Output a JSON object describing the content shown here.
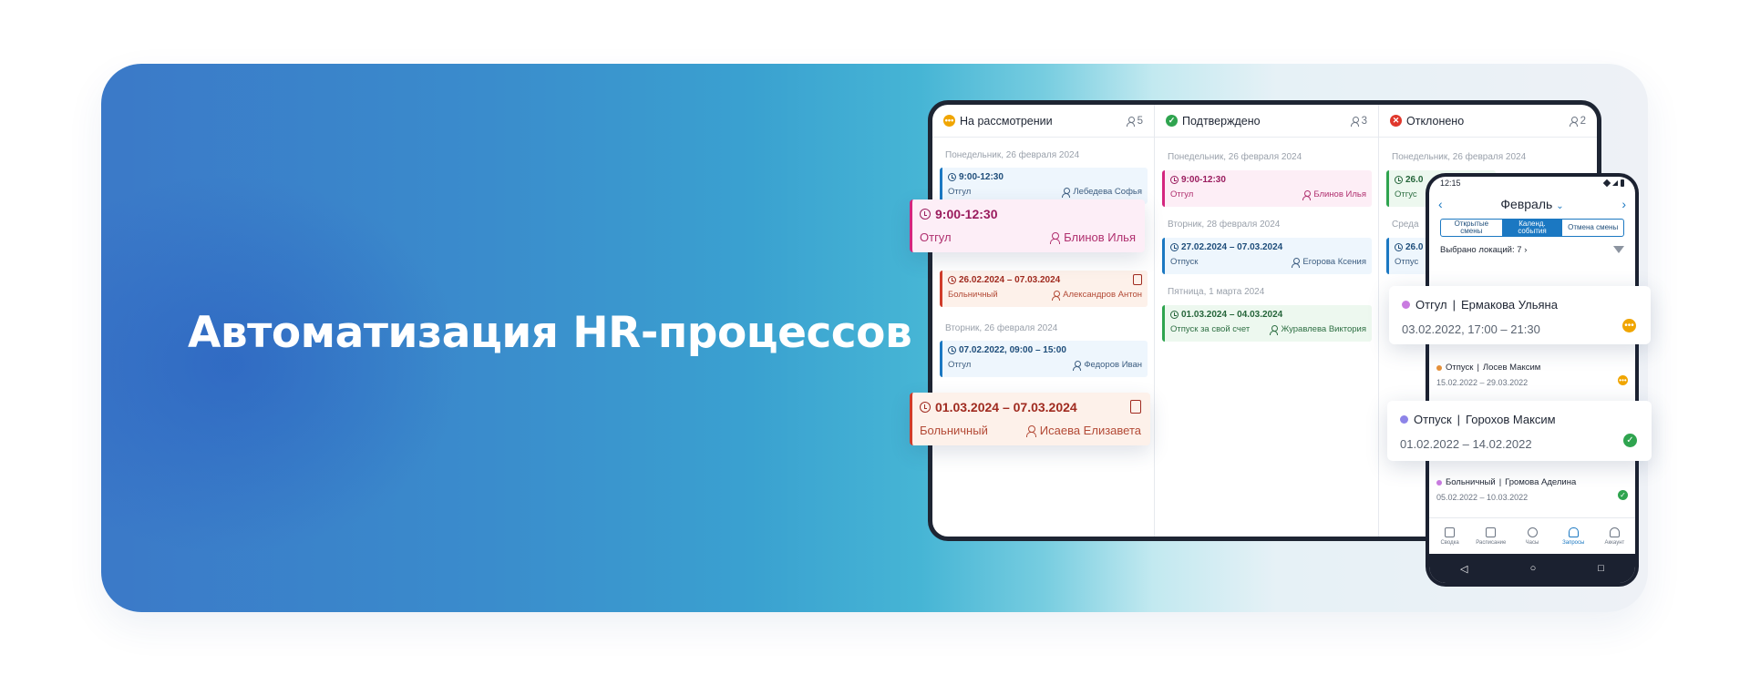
{
  "headline": "Автоматизация HR-процессов",
  "colors": {
    "pending": "#f0a500",
    "approved": "#2fa44f",
    "rejected": "#e0372c",
    "primary": "#1b78c2"
  },
  "tablet": {
    "columns": [
      {
        "title": "На рассмотрении",
        "status_icon": "pending-dots-icon",
        "count": "5"
      },
      {
        "title": "Подтверждено",
        "status_icon": "check-circle-icon",
        "count": "3"
      },
      {
        "title": "Отклонено",
        "status_icon": "x-circle-icon",
        "count": "2"
      }
    ],
    "col1": {
      "date1": "Понедельник, 26 февраля 2024",
      "c1": {
        "time": "9:00-12:30",
        "type": "Отгул",
        "person": "Лебедева Софья"
      },
      "c3": {
        "time": "26.02.2024 – 07.03.2024",
        "type": "Больничный",
        "person": "Александров Антон"
      },
      "date2": "Вторник, 26 февраля 2024",
      "c4": {
        "time": "07.02.2022, 09:00 – 15:00",
        "type": "Отгул",
        "person": "Федоров Иван"
      }
    },
    "col2": {
      "date1": "Понедельник, 26 февраля 2024",
      "c1": {
        "time": "9:00-12:30",
        "type": "Отгул",
        "person": "Блинов Илья"
      },
      "date2": "Вторник, 28 февраля 2024",
      "c2": {
        "time": "27.02.2024 – 07.03.2024",
        "type": "Отпуск",
        "person": "Егорова Ксения"
      },
      "date3": "Пятница, 1 марта 2024",
      "c3": {
        "time": "01.03.2024 – 04.03.2024",
        "type": "Отпуск за свой счет",
        "person": "Журавлева Виктория"
      }
    },
    "col3": {
      "date1": "Понедельник, 26 февраля 2024",
      "c1": {
        "time": "26.0",
        "type": "Отгус"
      },
      "date2": "Среда",
      "c2": {
        "time": "26.0",
        "type": "Отпус"
      }
    }
  },
  "float_cards": {
    "f1": {
      "time": "9:00-12:30",
      "type": "Отгул",
      "person": "Блинов Илья"
    },
    "f2": {
      "time": "01.03.2024 – 07.03.2024",
      "type": "Больничный",
      "person": "Исаева Елизавета"
    }
  },
  "phone": {
    "status_time": "12:15",
    "month": "Февраль",
    "segments": [
      "Открытые смены",
      "Календ. события",
      "Отмена смены"
    ],
    "locations": "Выбрано локаций: 7",
    "items": [
      {
        "type": "Отгул",
        "person": "Ермакова Ульяна",
        "dates": "03.02.2022, 17:00 – 21:30",
        "status": "pending"
      },
      {
        "type": "Отпуск",
        "person": "Лосев Максим",
        "dates": "15.02.2022 – 29.03.2022",
        "status": "pending"
      },
      {
        "type": "Отпуск",
        "person": "Горохов Максим",
        "dates": "01.02.2022 – 14.02.2022",
        "status": "approved"
      },
      {
        "type": "Больничный",
        "person": "Громова Аделина",
        "dates": "05.02.2022 – 10.03.2022",
        "status": "approved"
      }
    ],
    "tabs": [
      "Сводка",
      "Расписание",
      "Часы",
      "Запросы",
      "Аккаунт"
    ],
    "active_tab": "Запросы"
  }
}
